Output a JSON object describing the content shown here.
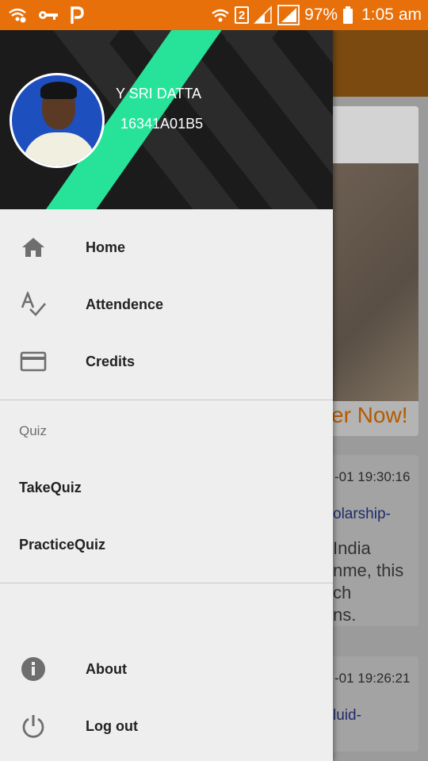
{
  "status_bar": {
    "battery": "97%",
    "time": "1:05 am",
    "sim_badge": "2",
    "icons": [
      "wifi-call-icon",
      "key-icon",
      "pinterest-p-icon",
      "wifi-icon",
      "signal-icon",
      "signal-icon",
      "battery-icon"
    ]
  },
  "drawer": {
    "user": {
      "name": "Y SRI DATTA",
      "id": "16341A01B5"
    },
    "primary_items": [
      {
        "label": "Home",
        "icon": "home-icon"
      },
      {
        "label": "Attendence",
        "icon": "spellcheck-icon"
      },
      {
        "label": "Credits",
        "icon": "credit-card-icon"
      }
    ],
    "quiz_section": {
      "title": "Quiz",
      "items": [
        {
          "label": "TakeQuiz"
        },
        {
          "label": "PracticeQuiz"
        }
      ]
    },
    "bottom_items": [
      {
        "label": "About",
        "icon": "info-icon"
      },
      {
        "label": "Log out",
        "icon": "power-icon"
      }
    ]
  },
  "background": {
    "card1_cta": "er Now!",
    "card2": {
      "timestamp": "-01 19:30:16",
      "link": "olarship-",
      "body": [
        "India",
        "nme, this",
        "ch",
        "ns."
      ]
    },
    "card3": {
      "timestamp": "-01 19:26:21",
      "link": "luid-"
    }
  },
  "colors": {
    "status_bar": "#e8700a",
    "drawer_bg": "#eeeeee",
    "header_bg": "#1b1b1b",
    "accent_stripe": "#27e39a",
    "cta": "#b35a00"
  }
}
